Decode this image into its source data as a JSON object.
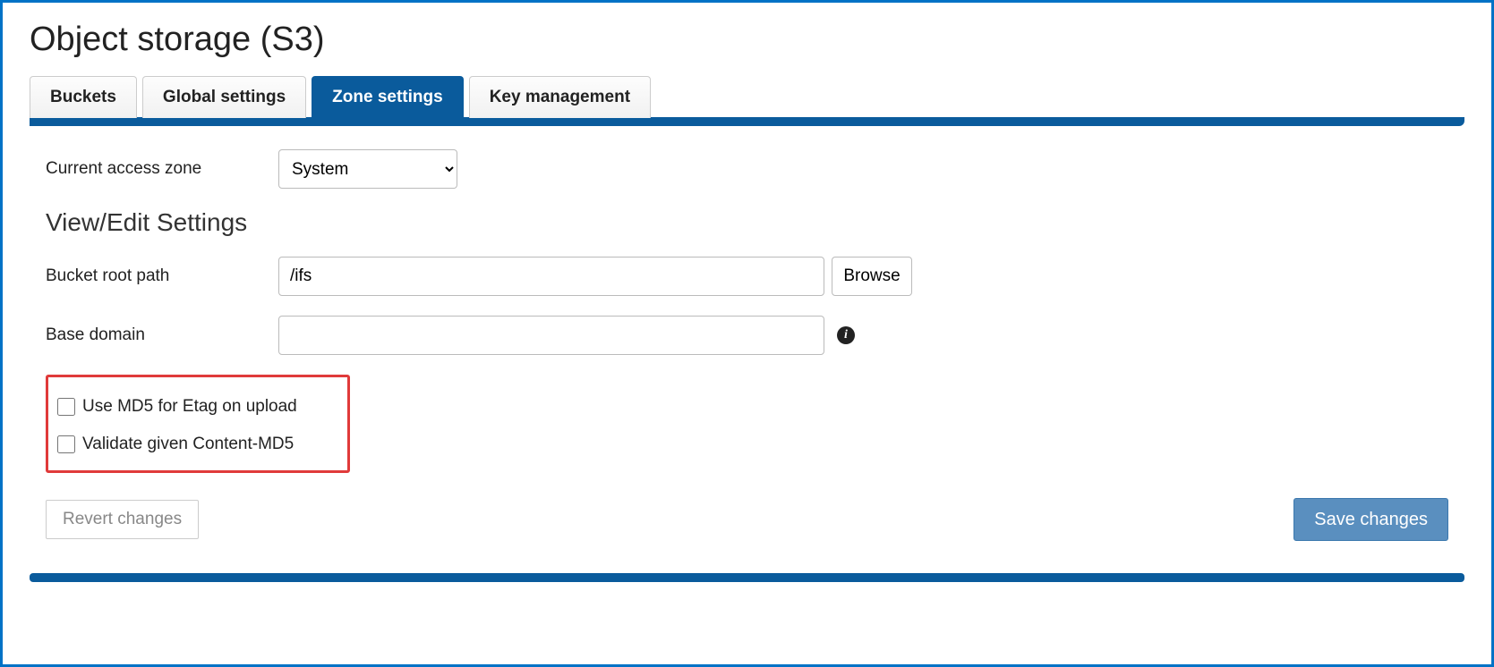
{
  "page_title": "Object storage (S3)",
  "tabs": {
    "buckets": "Buckets",
    "global": "Global settings",
    "zone": "Zone settings",
    "keymgmt": "Key management"
  },
  "zone": {
    "current_label": "Current access zone",
    "selected": "System"
  },
  "section_title": "View/Edit Settings",
  "fields": {
    "bucket_root_label": "Bucket root path",
    "bucket_root_value": "/ifs",
    "browse_label": "Browse",
    "base_domain_label": "Base domain",
    "base_domain_value": ""
  },
  "checks": {
    "use_md5": "Use MD5 for Etag on upload",
    "validate_md5": "Validate given Content-MD5"
  },
  "buttons": {
    "revert": "Revert changes",
    "save": "Save changes"
  },
  "info_icon_glyph": "i"
}
